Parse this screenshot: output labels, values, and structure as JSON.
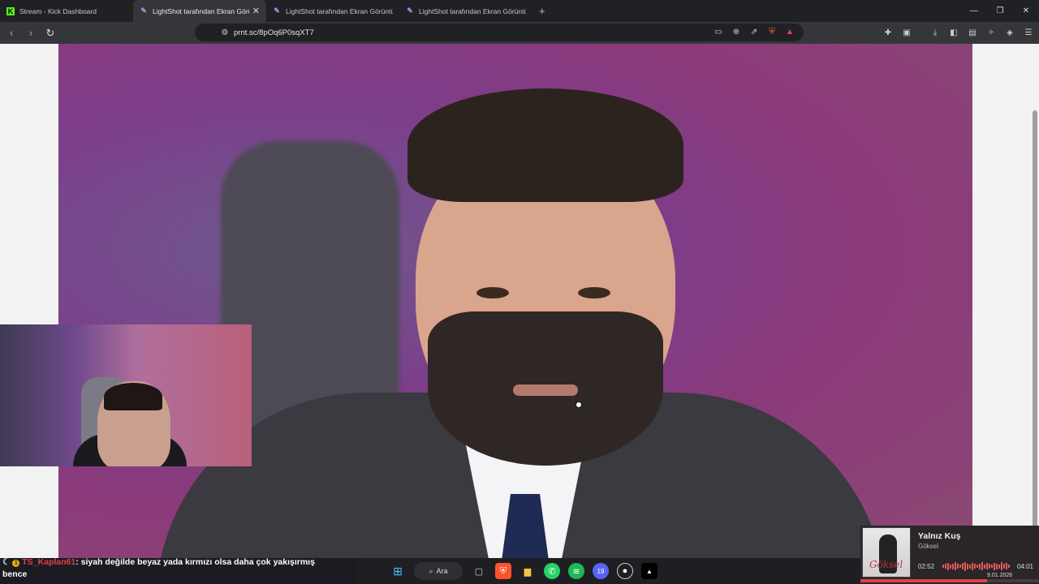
{
  "browser": {
    "tabs": [
      {
        "title": "Stream - Kick Dashboard",
        "active": false,
        "favicon": "kick-icon"
      },
      {
        "title": "LightShot tarafından Ekran Görünt",
        "active": true,
        "favicon": "lightshot-icon"
      },
      {
        "title": "LightShot tarafından Ekran Görüntüsü",
        "active": false,
        "favicon": "lightshot-icon"
      },
      {
        "title": "LightShot tarafından Ekran Görüntüsü",
        "active": false,
        "favicon": "lightshot-icon"
      }
    ],
    "url": "prnt.sc/8pOq6P0sqXT7"
  },
  "chat": {
    "username": "TS_Kaplan61",
    "message": ": siyah değilde beyaz yada kırmızı olsa daha çok yakışırmış",
    "message_cont": "bence"
  },
  "taskbar": {
    "search_label": "Ara",
    "discord_badge": "19"
  },
  "music": {
    "song": "Yalnız Kuş",
    "artist": "Göksel",
    "elapsed": "02:52",
    "duration": "04:01",
    "album_signature": "Göksel"
  },
  "clock": {
    "date": "9.01.2026"
  },
  "colors": {
    "accent": "#e0404a",
    "progress_fraction": 0.71
  }
}
